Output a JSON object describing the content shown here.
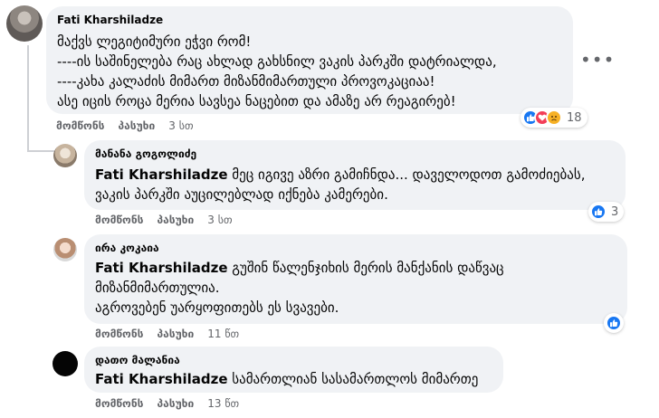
{
  "comments": [
    {
      "author": "Fati Kharshiladze",
      "lines": [
        "მაქვს ლეგიტიმური ეჭვი რომ!",
        "----ის საშინელება რაც ახლად გახსნილ ვაკის პარკში დატრიალდა,",
        "----კახა კალაძის მიმართ მიზანმიმართული პროვოკაციაა!",
        "ასე იცის როცა მერია სავსეა ნაცებით და ამაზე არ რეაგირებ!"
      ],
      "like": "მომწონს",
      "reply": "პასუხი",
      "time": "3 სთ",
      "reactions": {
        "count": "18",
        "icons": [
          "like",
          "love",
          "sad"
        ]
      },
      "more_icon": "more-horizontal-icon"
    },
    {
      "author": "მანანა გოგოლიძე",
      "mention": "Fati Kharshiladze",
      "first_line": " მეც იგივე აზრი გამიჩნდა... დაველოდოთ გამოძიებას,",
      "lines": [
        "ვაკის პარკში აუცილებლად იქნება კამერები."
      ],
      "like": "მომწონს",
      "reply": "პასუხი",
      "time": "3 სთ",
      "reactions": {
        "count": "3",
        "icons": [
          "like"
        ]
      }
    },
    {
      "author": "ირა კოკაია",
      "mention": "Fati Kharshiladze",
      "first_line": " გუშინ წალენჯიხის მერის მანქანის დაწვაც",
      "lines": [
        "მიზანმიმართულია.",
        "აგროვებენ უარყოფითებს ეს სვავები."
      ],
      "like": "მომწონს",
      "reply": "პასუხი",
      "time": "11 წთ",
      "reactions": {
        "count": "",
        "icons": [
          "like"
        ]
      }
    },
    {
      "author": "დათო მალანია",
      "mention": "Fati Kharshiladze",
      "first_line": " სამართლიან სასამართლოს მიმართე",
      "lines": [],
      "like": "მომწონს",
      "reply": "პასუხი",
      "time": "13 წთ"
    }
  ],
  "colors": {
    "bubble": "#f0f2f5",
    "like_blue": "#1877f2",
    "love_red": "#f33e58",
    "sad_yellow": "#f7b125",
    "meta_gray": "#65676b"
  }
}
